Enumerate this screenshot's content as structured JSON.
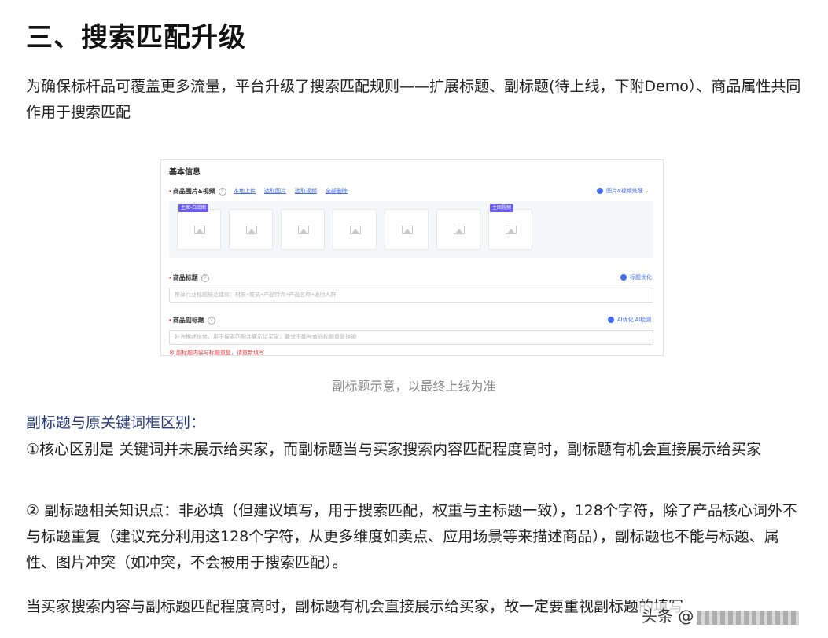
{
  "title": "三、搜索匹配升级",
  "intro": "为确保标杆品可覆盖更多流量，平台升级了搜索匹配规则——扩展标题、副标题(待上线，下附Demo）、商品属性共同作用于搜索匹配",
  "screenshot": {
    "section_title": "基本信息",
    "media_label": "商品图片&视频",
    "links": [
      "本地上传",
      "选取图片",
      "选取视频",
      "全部删除"
    ],
    "media_tool": "图片&视频处理",
    "main_tag": "主图-白底图",
    "video_tag": "主图视频",
    "title_label": "商品标题",
    "title_tool": "标题优化",
    "title_placeholder": "推荐行业标题规范建议：材质+款式+产品特点+产品名称+适用人群",
    "subtitle_label": "商品副标题",
    "subtitle_tool_1": "AI优化",
    "subtitle_tool_2": "AI检测",
    "subtitle_placeholder": "补充描述优势，用于搜索匹配并展示给买家，要求不能与商品标题重复堆砌",
    "error": "副标题内容与标题重复，请重新填写"
  },
  "caption": "副标题示意，以最终上线为准",
  "diff_heading": "副标题与原关键词框区别：",
  "point1": "①核心区别是 关键词并未展示给买家，而副标题当与买家搜索内容匹配程度高时，副标题有机会直接展示给买家",
  "point2": "② 副标题相关知识点：非必填（但建议填写，用于搜索匹配，权重与主标题一致），128个字符，除了产品核心词外不与标题重复（建议充分利用这128个字符，从更多维度如卖点、应用场景等来描述商品），副标题也不能与标题、属性、图片冲突（如冲突，不会被用于搜索匹配）。",
  "point3": "当买家搜索内容与副标题匹配程度高时，副标题有机会直接展示给买家，故一定要重视副标题的填写",
  "watermark": "头条 @"
}
